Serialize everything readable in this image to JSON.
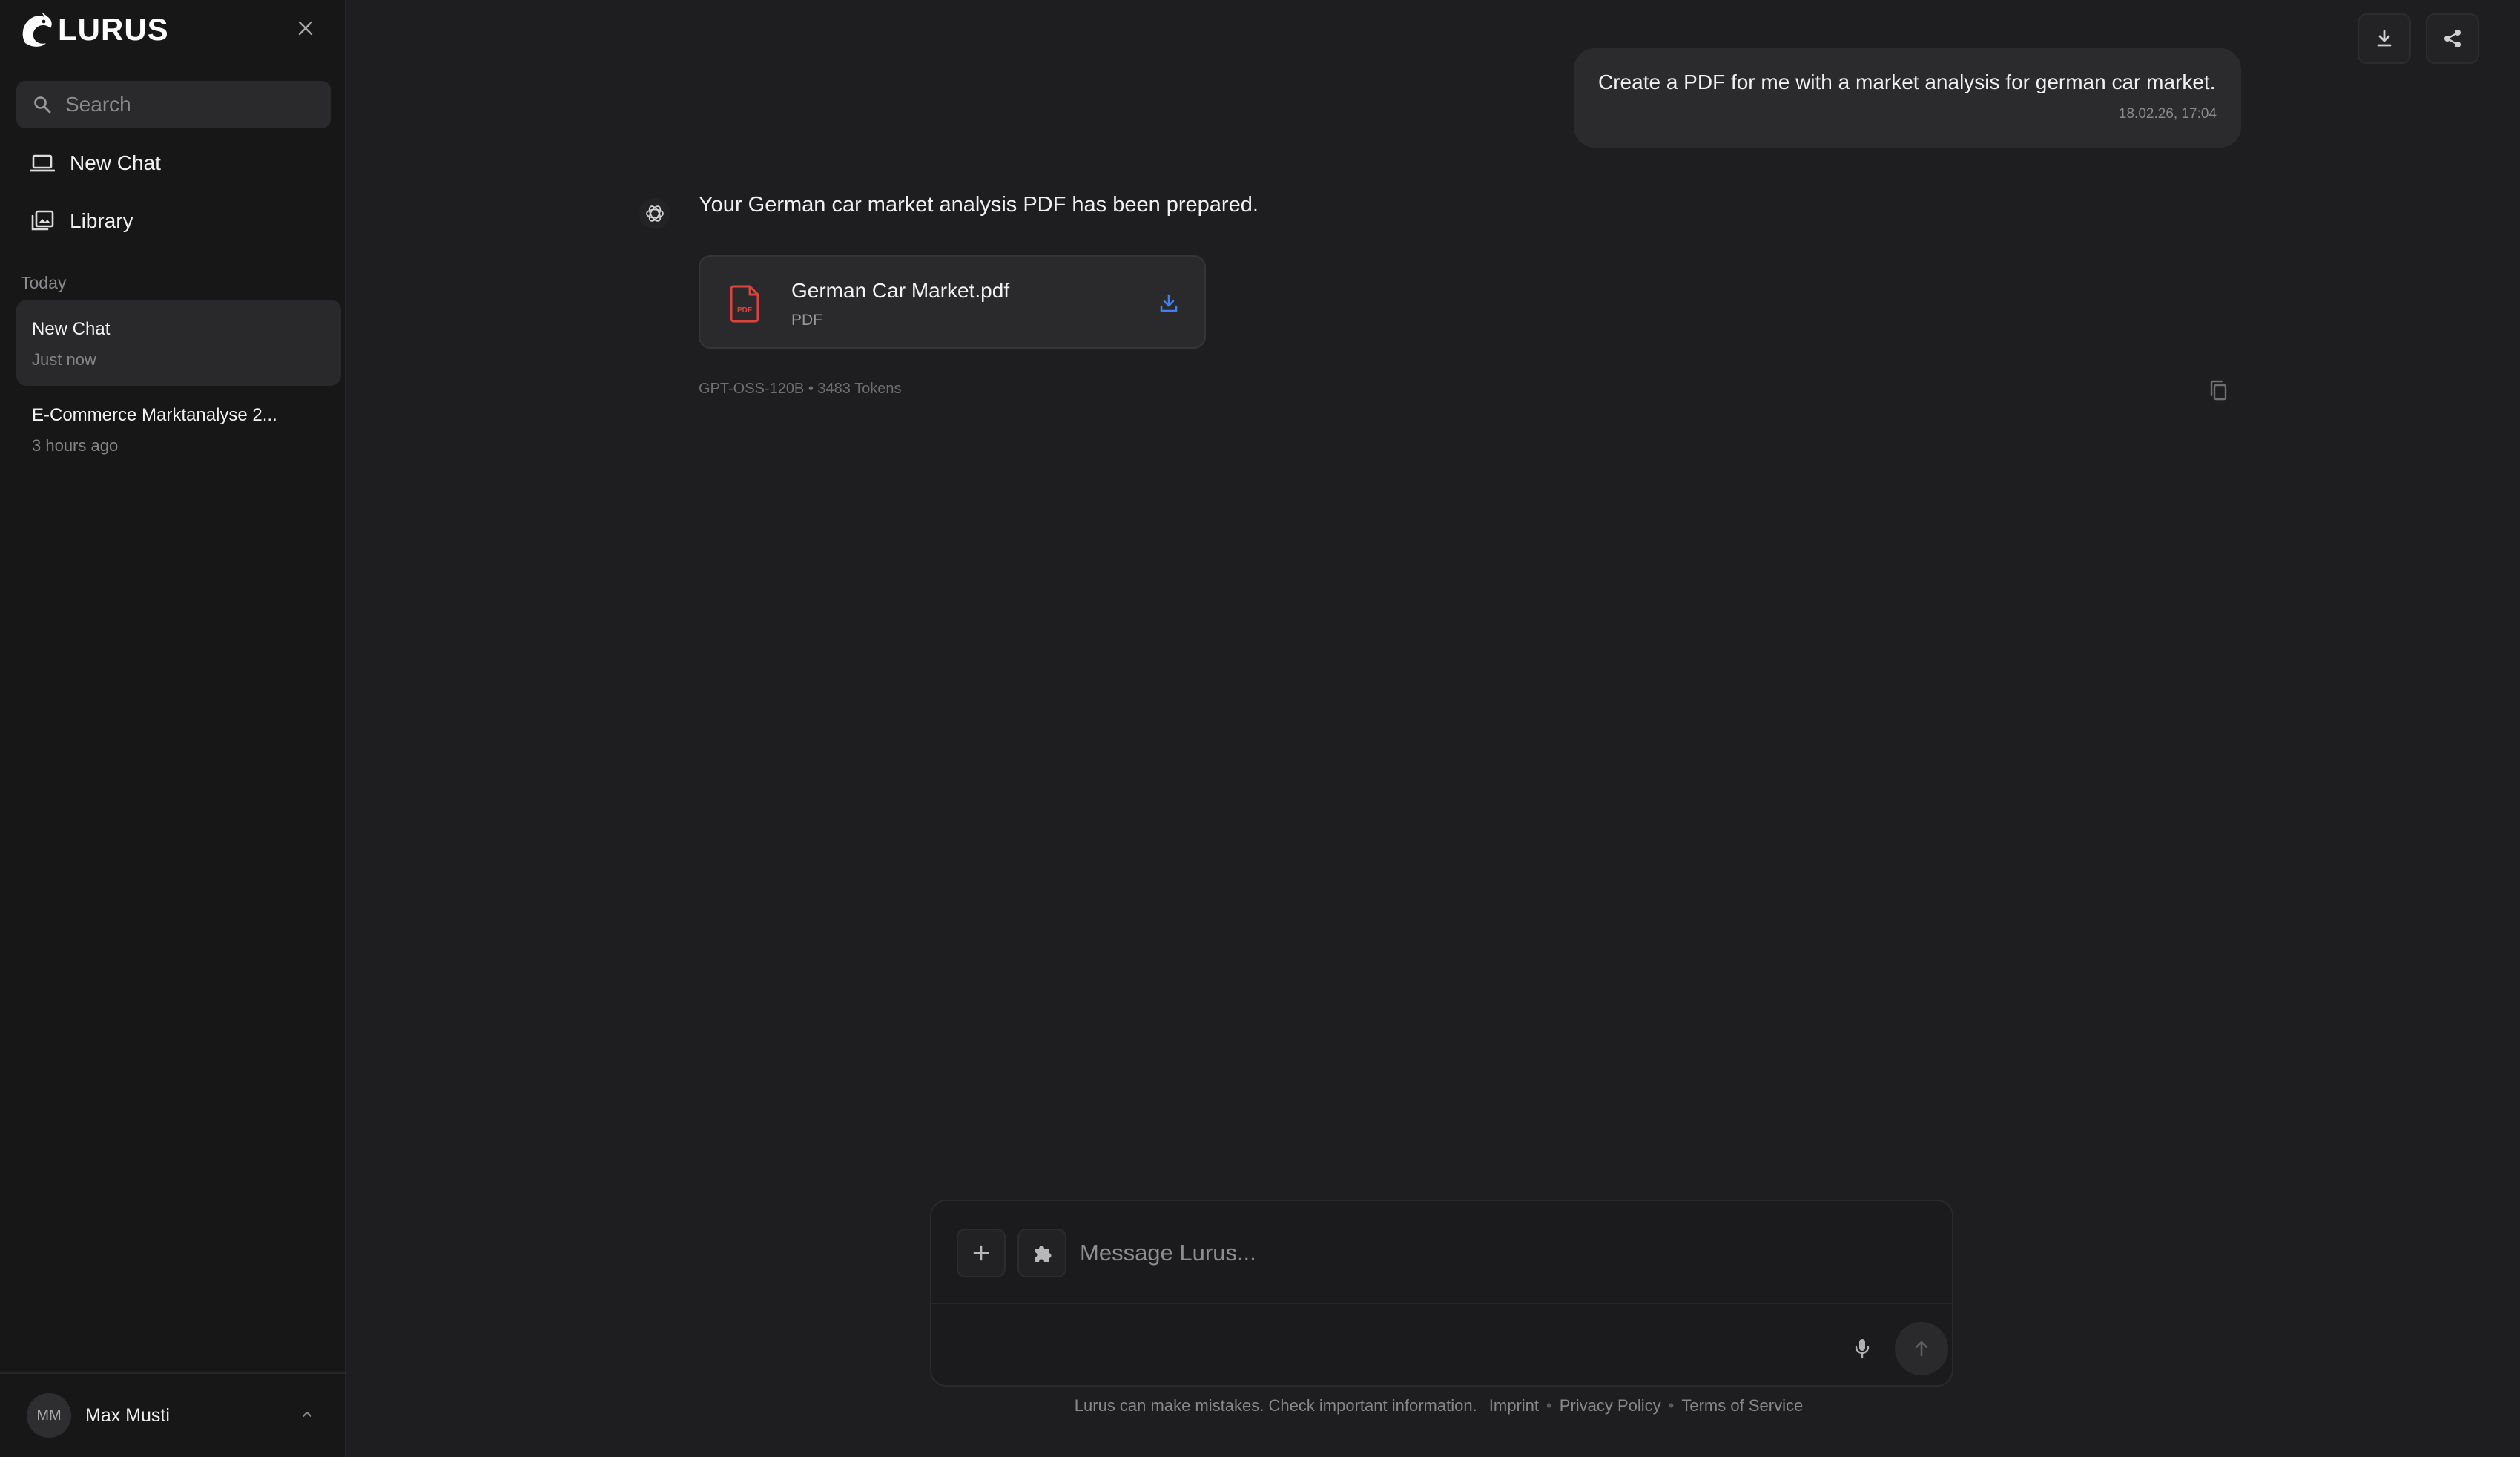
{
  "app": {
    "name": "LURUS"
  },
  "sidebar": {
    "search_placeholder": "Search",
    "nav": [
      {
        "label": "New Chat",
        "icon": "laptop-icon"
      },
      {
        "label": "Library",
        "icon": "library-icon"
      }
    ],
    "section_today": "Today",
    "chats": [
      {
        "title": "New Chat",
        "time": "Just now",
        "active": true
      },
      {
        "title": "E-Commerce Marktanalyse 2...",
        "time": "3 hours ago",
        "active": false
      }
    ],
    "user": {
      "initials": "MM",
      "name": "Max Musti"
    }
  },
  "conversation": {
    "user_message": {
      "text": "Create a PDF for me with a market analysis for german car market.",
      "timestamp": "18.02.26, 17:04"
    },
    "assistant_message": {
      "text": "Your German car market analysis PDF has been prepared.",
      "file": {
        "name": "German Car Market.pdf",
        "type": "PDF",
        "icon_label": "PDF"
      },
      "meta": "GPT-OSS-120B • 3483 Tokens"
    }
  },
  "composer": {
    "placeholder": "Message Lurus..."
  },
  "footer": {
    "disclaimer": "Lurus can make mistakes. Check important information.",
    "links": [
      "Imprint",
      "Privacy Policy",
      "Terms of Service"
    ]
  },
  "colors": {
    "background": "#1e1e20",
    "sidebar": "#171718",
    "bubble": "#2b2b2d",
    "pdf_red": "#d9453b",
    "download_blue": "#3b82f6"
  }
}
